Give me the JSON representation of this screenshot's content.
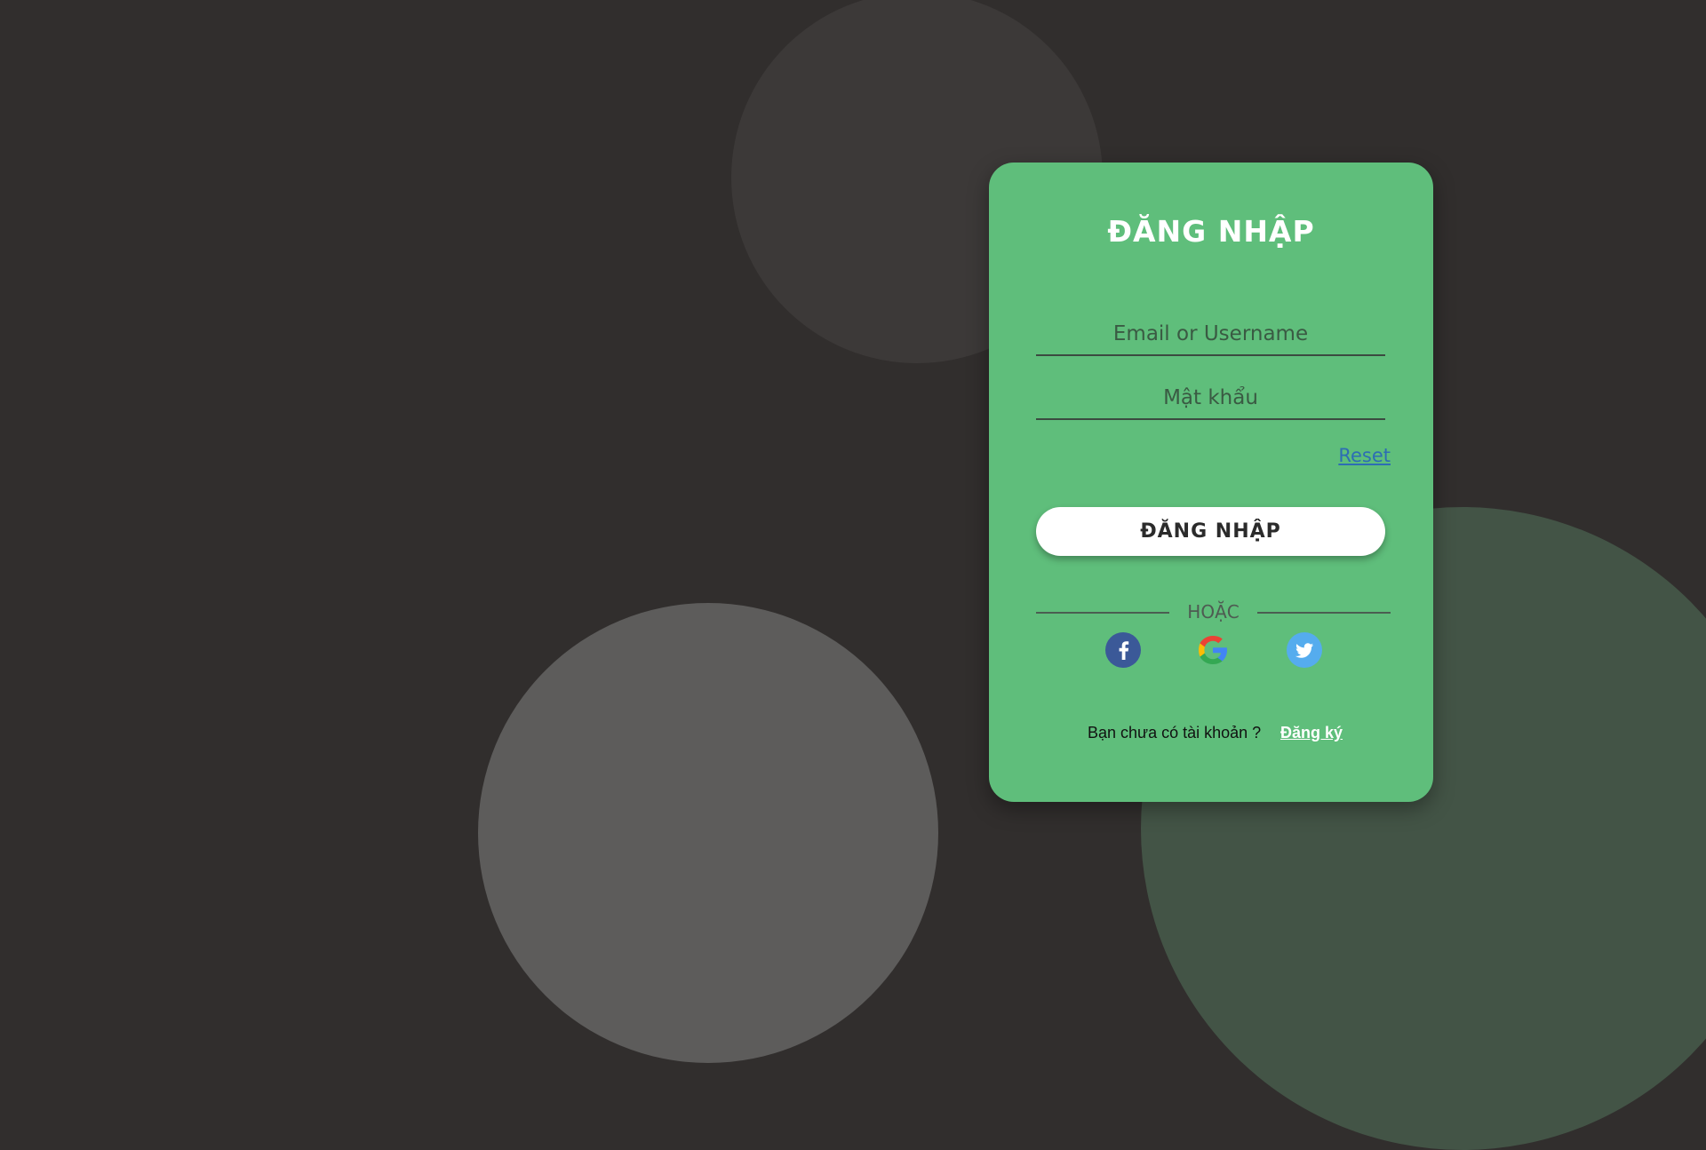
{
  "login_form": {
    "title": "ĐĂNG NHẬP",
    "email_placeholder": "Email or Username",
    "password_placeholder": "Mật khẩu",
    "reset_label": "Reset",
    "submit_label": "ĐĂNG NHẬP",
    "divider_label": "HOẶC",
    "social": [
      {
        "icon": "facebook-icon",
        "color": "#3b5998"
      },
      {
        "icon": "google-icon",
        "color": "#ffffff"
      },
      {
        "icon": "twitter-icon",
        "color": "#55acee"
      }
    ],
    "signup_prompt": "Bạn chưa có tài khoản ?",
    "signup_label": "Đăng ký"
  },
  "colors": {
    "background": "#312e2d",
    "card": "#5fbe7b",
    "button": "#ffffff",
    "link": "#2d6db4"
  }
}
